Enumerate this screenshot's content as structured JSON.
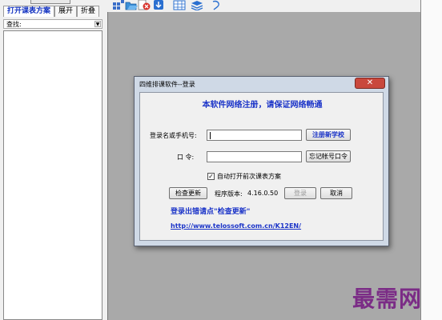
{
  "left_panel": {
    "tabs": [
      {
        "label": "打开课表方案",
        "active": true
      },
      {
        "label": "展开",
        "active": false
      },
      {
        "label": "折叠",
        "active": false
      }
    ],
    "search_label": "查找:"
  },
  "toolbar": {
    "icons": [
      "nav-icon",
      "open-folder-icon",
      "delete-icon",
      "download-icon",
      "grid-icon",
      "layers-icon",
      "refresh-icon"
    ]
  },
  "dialog": {
    "title": "四维排课软件--登录",
    "notice": "本软件网络注册，请保证网络畅通",
    "username_label": "登录名或手机号:",
    "username_value": "",
    "password_label": "口  令:",
    "password_value": "",
    "register_button": "注册新学校",
    "forgot_button": "忘记帐号口令",
    "autoload_label": "自动打开前次课表方案",
    "autoload_checked": true,
    "update_button": "检查更新",
    "version_label": "程序版本:",
    "version": "4.16.0.50",
    "login_button": "登录",
    "cancel_button": "取消",
    "hint": "登录出错请点\"检查更新\"",
    "link": "http://www.telossoft.com.cn/K12EN/"
  },
  "watermark": "最需网",
  "colors": {
    "accent": "#1a33c8",
    "workspace": "#a9a9a9",
    "close": "#c9483d",
    "watermark": "#7b2c86"
  }
}
